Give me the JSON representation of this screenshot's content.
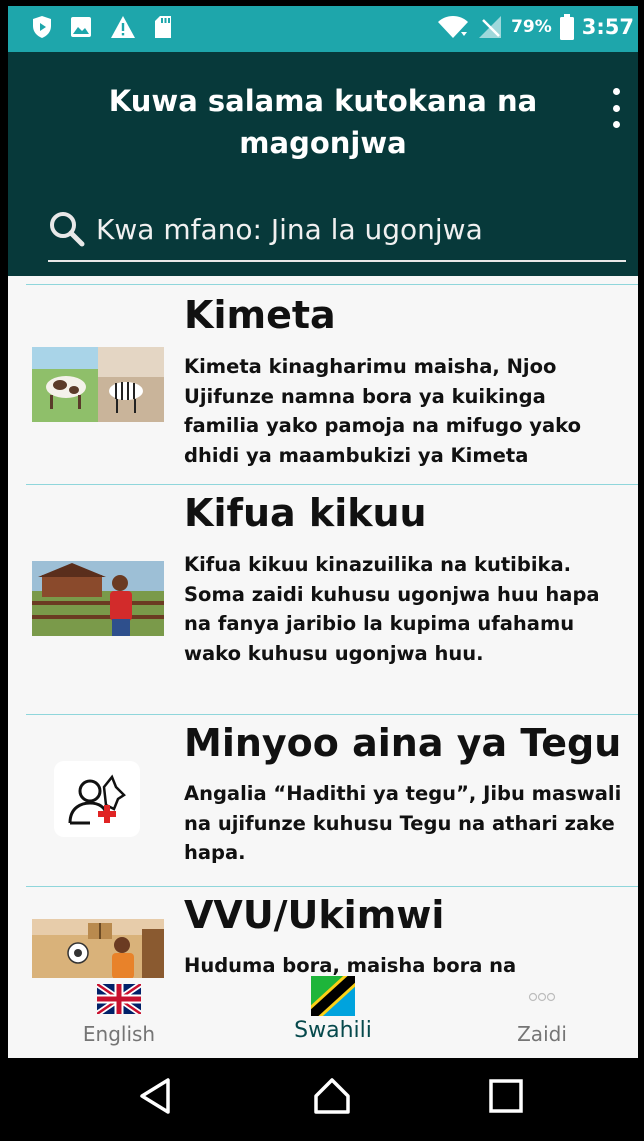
{
  "status_bar": {
    "icons_left": [
      "shield-icon",
      "image-icon",
      "warning-icon",
      "sd-card-icon"
    ],
    "icons_right": [
      "wifi-icon",
      "no-signal-icon",
      "battery-icon"
    ],
    "battery": "79%",
    "time": "3:57"
  },
  "header": {
    "title": "Kuwa salama kutokana na magonjwa",
    "menu_icon": "more-vert-icon"
  },
  "search": {
    "icon": "search-icon",
    "placeholder": "Kwa mfano: Jina la ugonjwa"
  },
  "diseases": [
    {
      "title": "Kimeta",
      "description": "Kimeta kinagharimu maisha, Njoo Ujifunze namna bora ya kuikinga familia yako pamoja na mifugo yako dhidi ya maambukizi ya Kimeta",
      "thumbnail": "cow-zebra-illustration"
    },
    {
      "title": "Kifua kikuu",
      "description": "Kifua kikuu kinazuilika na kutibika. Soma zaidi kuhusu ugonjwa huu hapa na fanya jaribio la kupima ufahamu wako kuhusu ugonjwa huu.",
      "thumbnail": "farmer-illustration"
    },
    {
      "title": "Minyoo aina ya Tegu",
      "description": "Angalia “Hadithi ya tegu”, Jibu maswali na ujifunze kuhusu Tegu na athari zake hapa.",
      "thumbnail": "person-dog-health-icon"
    },
    {
      "title": "VVU/Ukimwi",
      "description": "Huduma bora, maisha bora na",
      "thumbnail": "clinic-illustration"
    }
  ],
  "bottom_nav": {
    "tabs": [
      {
        "label": "English",
        "icon": "uk-flag-icon"
      },
      {
        "label": "Swahili",
        "icon": "tanzania-flag-icon"
      },
      {
        "label": "Zaidi",
        "icon": "more-icon"
      }
    ],
    "active_tab": "Swahili"
  },
  "colors": {
    "status_bar": "#1ea6ab",
    "app_bar": "#07393a",
    "divider": "#8fd6db",
    "active_tab": "#06494c",
    "inactive_tab": "#757575"
  },
  "system_nav": {
    "buttons": [
      "back-icon",
      "home-icon",
      "recents-icon"
    ]
  }
}
